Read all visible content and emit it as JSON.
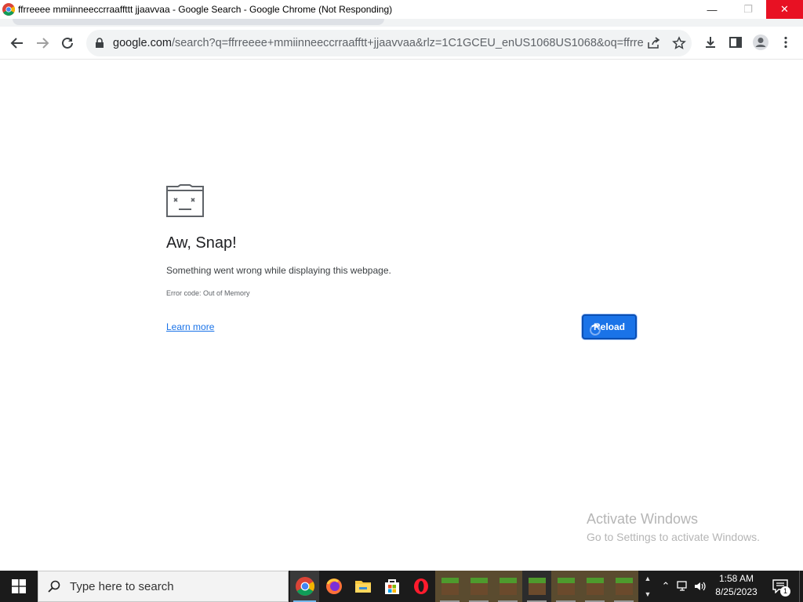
{
  "window": {
    "title": "ffrreeee mmiinneeccrraaffttt jjaavvaa - Google Search - Google Chrome (Not Responding)",
    "minimize_icon": "minimize-icon",
    "restore_icon": "restore-icon",
    "close_icon": "close-icon"
  },
  "toolbar": {
    "url_host": "google.com",
    "url_rest": "/search?q=ffrreeee+mmiinneeccrraafftt+jjaavvaa&rlz=1C1GCEU_enUS1068US1068&oq=ffrreee..."
  },
  "error_page": {
    "title": "Aw, Snap!",
    "message": "Something went wrong while displaying this webpage.",
    "code": "Error code: Out of Memory",
    "learn_more": "Learn more",
    "reload": "Reload"
  },
  "watermark": {
    "line1": "Activate Windows",
    "line2": "Go to Settings to activate Windows."
  },
  "taskbar": {
    "search_placeholder": "Type here to search",
    "apps": [
      "chrome",
      "firefox",
      "file-explorer",
      "microsoft-store",
      "opera",
      "minecraft",
      "minecraft",
      "minecraft",
      "minecraft",
      "minecraft",
      "minecraft",
      "minecraft"
    ],
    "time": "1:58 AM",
    "date": "8/25/2023",
    "notification_count": "1"
  },
  "colors": {
    "accent": "#1a73e8",
    "close_red": "#e81123",
    "taskbar": "#1b1b1b"
  }
}
